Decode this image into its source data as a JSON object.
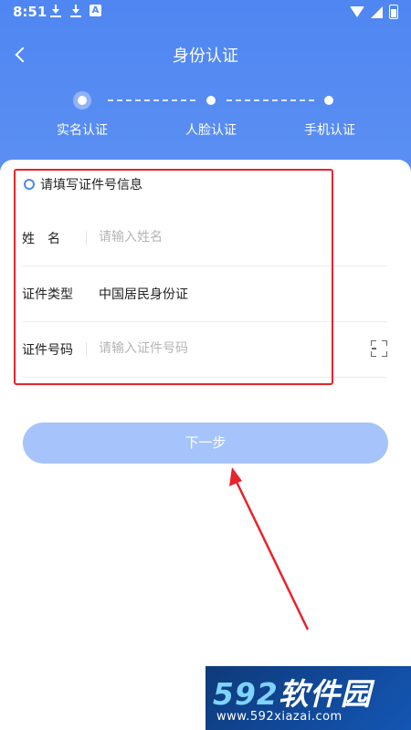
{
  "status_bar": {
    "time": "8:51",
    "a_icon_text": "A"
  },
  "nav": {
    "title": "身份认证"
  },
  "steps": [
    {
      "label": "实名认证",
      "state": "active"
    },
    {
      "label": "人脸认证",
      "state": "pending"
    },
    {
      "label": "手机认证",
      "state": "pending"
    }
  ],
  "form": {
    "section_heading": "请填写证件号信息",
    "name_row": {
      "label": "姓　名",
      "placeholder": "请输入姓名",
      "value": ""
    },
    "id_type_row": {
      "label": "证件类型",
      "value": "中国居民身份证"
    },
    "id_number_row": {
      "label": "证件号码",
      "placeholder": "请输入证件号码",
      "value": ""
    }
  },
  "next_button": {
    "label": "下一步"
  },
  "watermark": {
    "logo_digits": "592",
    "logo_text": "软件园",
    "url": "www.592xiazai.com"
  },
  "colors": {
    "header": "#4f86f1",
    "button": "#a6c4fb",
    "highlight": "#e8232b"
  },
  "icons": [
    "download-icon",
    "a-icon",
    "wifi-icon",
    "signal-icon",
    "battery-icon",
    "back-icon",
    "ring-icon",
    "scan-icon"
  ]
}
